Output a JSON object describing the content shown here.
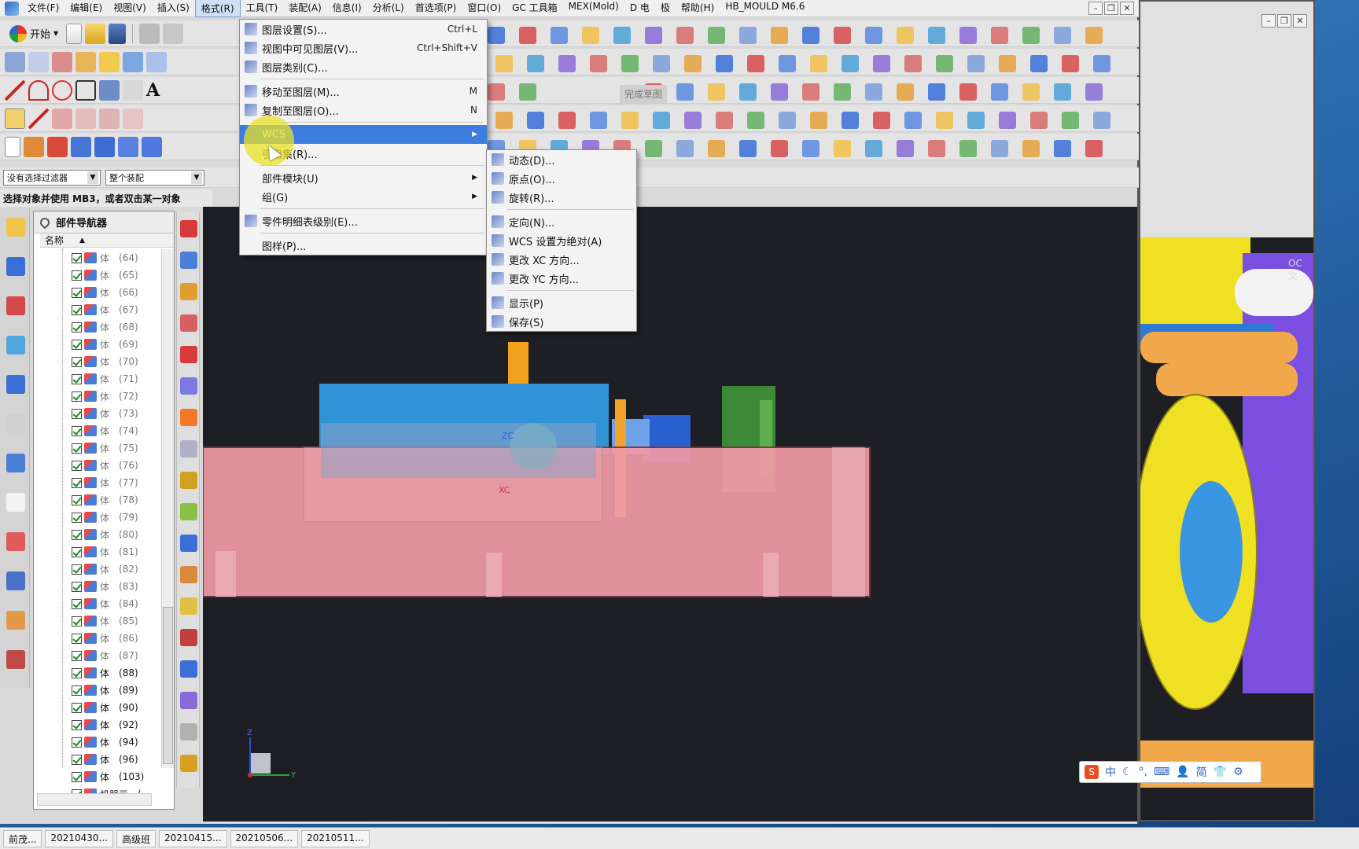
{
  "menubar": {
    "items": [
      "文件(F)",
      "编辑(E)",
      "视图(V)",
      "插入(S)",
      "格式(R)",
      "工具(T)",
      "装配(A)",
      "信息(I)",
      "分析(L)",
      "首选项(P)",
      "窗口(O)",
      "GC 工具箱",
      "MEX(Mold)",
      "D 电",
      "极",
      "帮助(H)",
      "HB_MOULD M6.6"
    ],
    "active_index": 4
  },
  "toolbar": {
    "start_label": "开始"
  },
  "sketch": {
    "finish_label": "完成草图"
  },
  "filter": {
    "type_value": "没有选择过滤器",
    "scope_value": "整个装配"
  },
  "status": {
    "prompt": "选择对象并使用 MB3，或者双击某一对象"
  },
  "navigator": {
    "title": "部件导航器",
    "column_name": "名称",
    "rows": [
      {
        "name": "体",
        "num": "(64)",
        "dim": true
      },
      {
        "name": "体",
        "num": "(65)",
        "dim": true
      },
      {
        "name": "体",
        "num": "(66)",
        "dim": true
      },
      {
        "name": "体",
        "num": "(67)",
        "dim": true
      },
      {
        "name": "体",
        "num": "(68)",
        "dim": true
      },
      {
        "name": "体",
        "num": "(69)",
        "dim": true
      },
      {
        "name": "体",
        "num": "(70)",
        "dim": true
      },
      {
        "name": "体",
        "num": "(71)",
        "dim": true
      },
      {
        "name": "体",
        "num": "(72)",
        "dim": true
      },
      {
        "name": "体",
        "num": "(73)",
        "dim": true
      },
      {
        "name": "体",
        "num": "(74)",
        "dim": true
      },
      {
        "name": "体",
        "num": "(75)",
        "dim": true
      },
      {
        "name": "体",
        "num": "(76)",
        "dim": true
      },
      {
        "name": "体",
        "num": "(77)",
        "dim": true
      },
      {
        "name": "体",
        "num": "(78)",
        "dim": true
      },
      {
        "name": "体",
        "num": "(79)",
        "dim": true
      },
      {
        "name": "体",
        "num": "(80)",
        "dim": true
      },
      {
        "name": "体",
        "num": "(81)",
        "dim": true
      },
      {
        "name": "体",
        "num": "(82)",
        "dim": true
      },
      {
        "name": "体",
        "num": "(83)",
        "dim": true
      },
      {
        "name": "体",
        "num": "(84)",
        "dim": true
      },
      {
        "name": "体",
        "num": "(85)",
        "dim": true
      },
      {
        "name": "体",
        "num": "(86)",
        "dim": true
      },
      {
        "name": "体",
        "num": "(87)",
        "dim": true
      },
      {
        "name": "体",
        "num": "(88)",
        "dim": false
      },
      {
        "name": "体",
        "num": "(89)",
        "dim": false
      },
      {
        "name": "体",
        "num": "(90)",
        "dim": false
      },
      {
        "name": "体",
        "num": "(92)",
        "dim": false
      },
      {
        "name": "体",
        "num": "(94)",
        "dim": false
      },
      {
        "name": "体",
        "num": "(96)",
        "dim": false
      },
      {
        "name": "体",
        "num": "(103)",
        "dim": false
      },
      {
        "name": "机器示",
        "num": "(",
        "dim": false
      }
    ]
  },
  "format_menu": {
    "items": [
      {
        "label": "图层设置(S)...",
        "shortcut": "Ctrl+L",
        "icon": "layer-settings-icon"
      },
      {
        "label": "视图中可见图层(V)...",
        "shortcut": "Ctrl+Shift+V",
        "icon": "visible-layers-icon"
      },
      {
        "label": "图层类别(C)...",
        "shortcut": "",
        "icon": "layer-category-icon"
      },
      {
        "sep": true
      },
      {
        "label": "移动至图层(M)...",
        "shortcut": "M",
        "icon": "move-to-layer-icon"
      },
      {
        "label": "复制至图层(O)...",
        "shortcut": "N",
        "icon": "copy-to-layer-icon"
      },
      {
        "sep": true
      },
      {
        "label": "WCS",
        "submenu": true,
        "highlight": true,
        "icon": ""
      },
      {
        "label": "引用集(R)...",
        "shortcut": "",
        "icon": ""
      },
      {
        "sep": true
      },
      {
        "label": "部件模块(U)",
        "submenu": true,
        "icon": ""
      },
      {
        "label": "组(G)",
        "submenu": true,
        "icon": ""
      },
      {
        "sep": true
      },
      {
        "label": "零件明细表级别(E)...",
        "shortcut": "",
        "icon": "parts-list-level-icon"
      },
      {
        "sep": true
      },
      {
        "label": "图样(P)...",
        "shortcut": "",
        "icon": ""
      }
    ]
  },
  "wcs_menu": {
    "items": [
      {
        "label": "动态(D)...",
        "icon": "wcs-dynamic-icon"
      },
      {
        "label": "原点(O)...",
        "icon": "wcs-origin-icon"
      },
      {
        "label": "旋转(R)...",
        "icon": "wcs-rotate-icon"
      },
      {
        "sep": true
      },
      {
        "label": "定向(N)...",
        "icon": "wcs-orient-icon"
      },
      {
        "label": "WCS 设置为绝对(A)",
        "icon": "wcs-absolute-icon"
      },
      {
        "label": "更改 XC 方向...",
        "icon": "change-xc-icon"
      },
      {
        "label": "更改 YC 方向...",
        "icon": "change-yc-icon"
      },
      {
        "sep": true
      },
      {
        "label": "显示(P)",
        "icon": "wcs-display-icon"
      },
      {
        "label": "保存(S)",
        "icon": "wcs-save-icon"
      }
    ]
  },
  "viewport": {
    "wcs_zc": "ZC",
    "wcs_xc": "XC",
    "triad_z": "Z",
    "triad_y": "Y"
  },
  "win2": {
    "side_text": "OC 文"
  },
  "ime": {
    "items": [
      "中",
      "简"
    ]
  },
  "taskbar": {
    "items": [
      "前茂...",
      "20210430...",
      "高级班",
      "20210415...",
      "20210506...",
      "20210511..."
    ]
  },
  "colors": {
    "menu_highlight": "#3d7ddf",
    "viewport_bg": "#1e1f24",
    "mold_plate": "#f19aa6",
    "accent_blue": "#2b8fd6"
  }
}
